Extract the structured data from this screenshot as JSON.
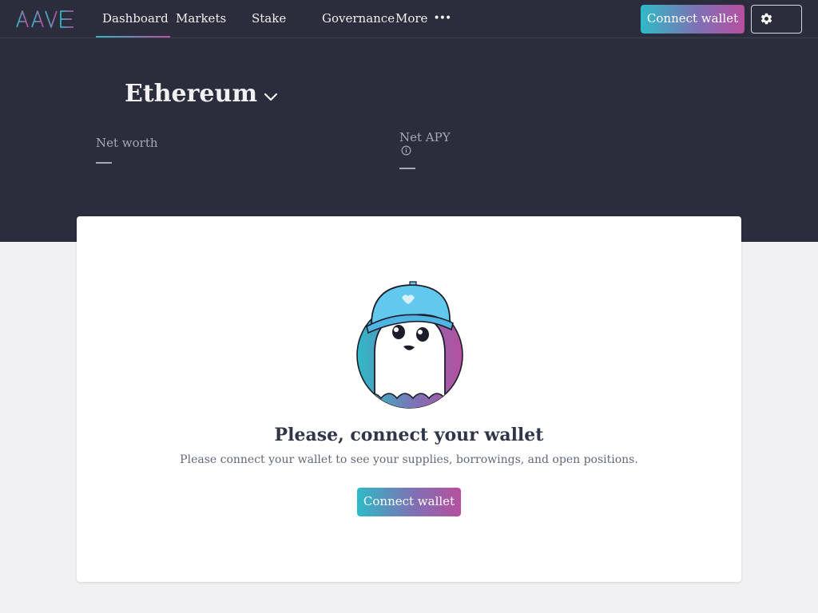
{
  "nav": {
    "logo_text": "AAVE",
    "items": [
      {
        "label": "Dashboard",
        "active": true
      },
      {
        "label": "Markets",
        "active": false
      },
      {
        "label": "Stake",
        "active": false
      },
      {
        "label": "Governance",
        "active": false
      }
    ],
    "more_label": "More",
    "more_dots": "•••",
    "connect_label": "Connect wallet",
    "settings_icon": "gear-icon"
  },
  "hero": {
    "market_name": "Ethereum",
    "net_worth_label": "Net worth",
    "net_apy_label": "Net APY"
  },
  "card": {
    "title": "Please, connect your wallet",
    "subtitle": "Please connect your wallet to see your supplies, borrowings, and open positions.",
    "connect_label": "Connect wallet"
  },
  "colors": {
    "header_bg": "#2b2d3c",
    "page_bg": "#f1f1f3",
    "accent_teal": "#2ebac6",
    "accent_pink": "#b6509e"
  }
}
